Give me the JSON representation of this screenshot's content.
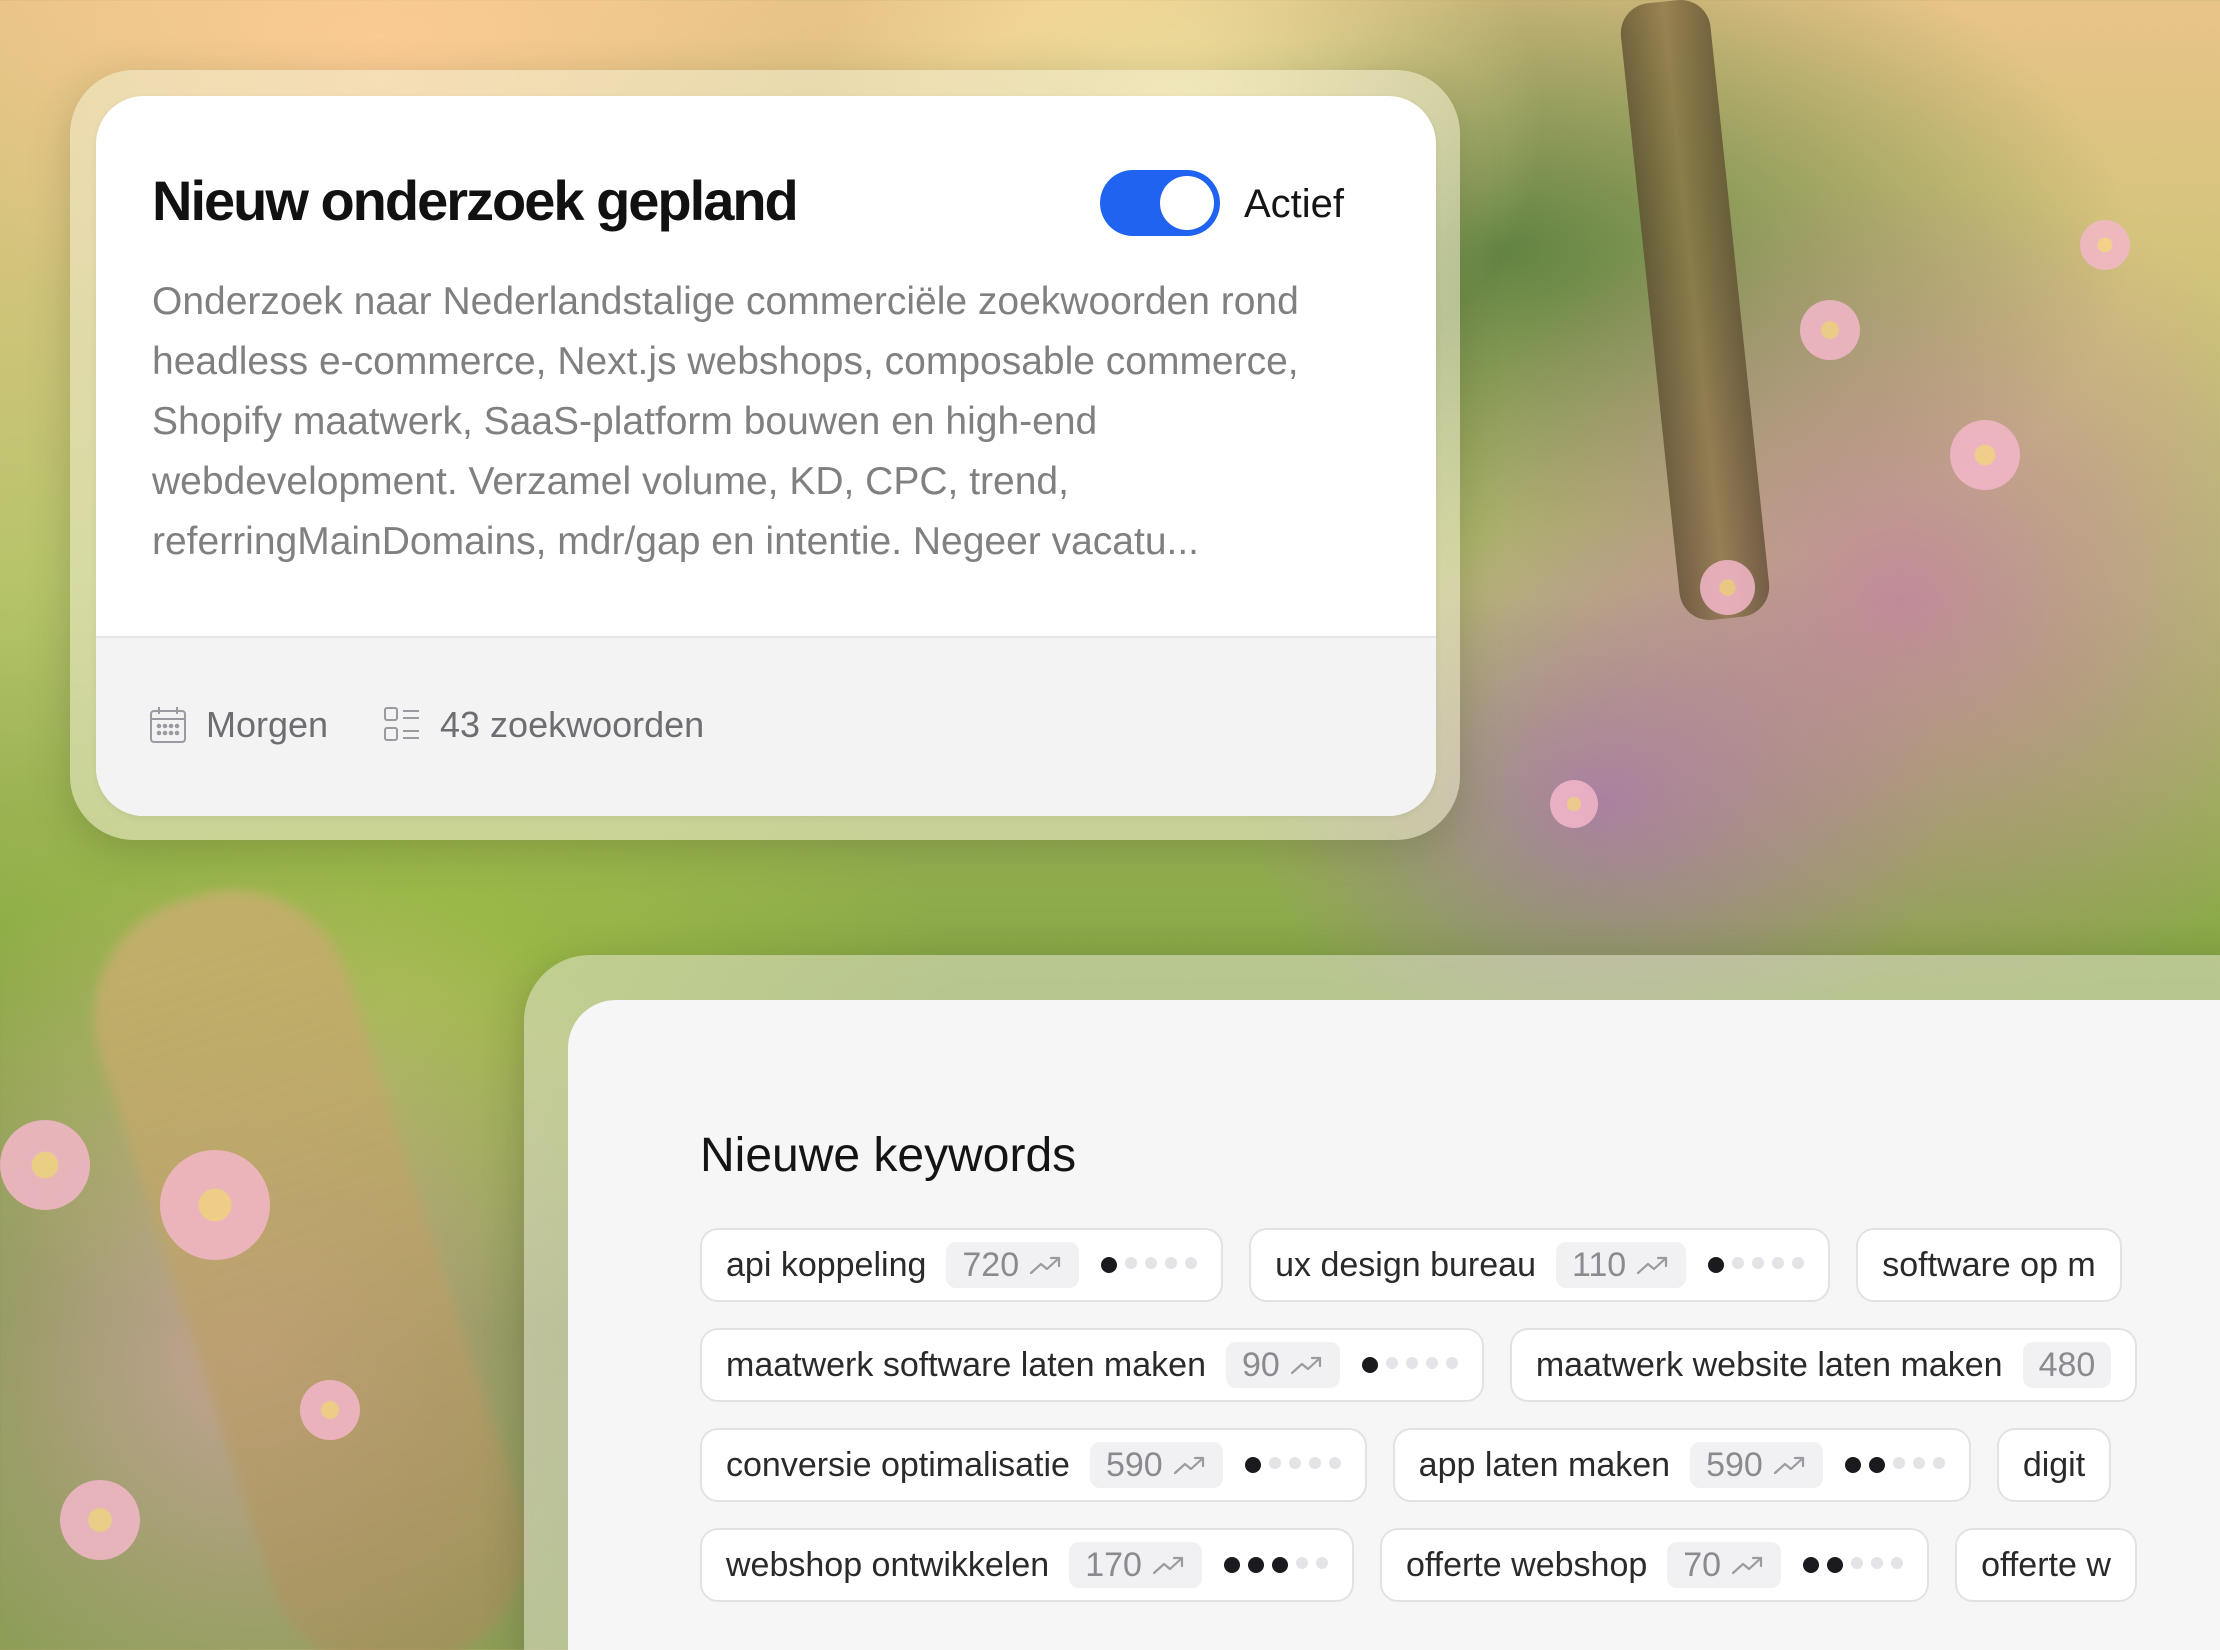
{
  "colors": {
    "accent": "#1f63f0",
    "card_bg": "#ffffff",
    "muted_text": "#808080"
  },
  "task_card": {
    "title": "Nieuw onderzoek gepland",
    "toggle": {
      "on": true,
      "label": "Actief"
    },
    "description": "Onderzoek naar Nederlandstalige commerciële zoekwoorden rond headless e-commerce, Next.js webshops, composable commerce, Shopify maatwerk, SaaS-platform bouwen en high-end webdevelopment. Verzamel volume, KD, CPC, trend, referringMainDomains, mdr/gap en intentie. Negeer vacatu...",
    "schedule": {
      "icon": "calendar-icon",
      "label": "Morgen"
    },
    "keyword_count": {
      "icon": "list-icon",
      "label": "43 zoekwoorden"
    }
  },
  "keywords_card": {
    "title": "Nieuwe keywords",
    "trend_icon": "trend-up-icon",
    "difficulty_scale": 5,
    "rows": [
      [
        {
          "keyword": "api koppeling",
          "volume": "720",
          "difficulty": 1
        },
        {
          "keyword": "ux design bureau",
          "volume": "110",
          "difficulty": 1
        },
        {
          "keyword": "software op m",
          "volume": "",
          "difficulty": null
        }
      ],
      [
        {
          "keyword": "maatwerk software laten maken",
          "volume": "90",
          "difficulty": 1
        },
        {
          "keyword": "maatwerk website laten maken",
          "volume": "480",
          "difficulty": null
        }
      ],
      [
        {
          "keyword": "conversie optimalisatie",
          "volume": "590",
          "difficulty": 1
        },
        {
          "keyword": "app laten maken",
          "volume": "590",
          "difficulty": 2
        },
        {
          "keyword": "digit",
          "volume": "",
          "difficulty": null
        }
      ],
      [
        {
          "keyword": "webshop ontwikkelen",
          "volume": "170",
          "difficulty": 3
        },
        {
          "keyword": "offerte webshop",
          "volume": "70",
          "difficulty": 2
        },
        {
          "keyword": "offerte w",
          "volume": "",
          "difficulty": null
        }
      ]
    ]
  }
}
